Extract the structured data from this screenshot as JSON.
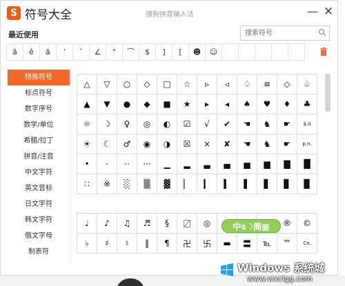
{
  "window": {
    "logo_letter": "S",
    "title": "符号大全",
    "ime_name": "搜狗拼音输入法",
    "minimize": "—",
    "close": "✕"
  },
  "recent": {
    "label": "最近使用",
    "symbols": [
      "ä",
      "ê",
      "ã",
      "’",
      "˘",
      "∠",
      "°",
      "⌒",
      "$",
      "]",
      "[",
      "☻",
      "☺",
      "",
      "",
      "",
      "",
      ""
    ]
  },
  "search": {
    "placeholder": "搜索符号"
  },
  "sidebar": {
    "items": [
      {
        "label": "特殊符号",
        "active": true
      },
      {
        "label": "标点符号"
      },
      {
        "label": "数字序号"
      },
      {
        "label": "数学/单位"
      },
      {
        "label": "希腊/拉丁"
      },
      {
        "label": "拼音/注音"
      },
      {
        "label": "中文字符"
      },
      {
        "label": "英文音标"
      },
      {
        "label": "日文字符"
      },
      {
        "label": "韩文字符"
      },
      {
        "label": "俄文字母"
      },
      {
        "label": "制表符"
      }
    ]
  },
  "grid1": [
    "△",
    "▽",
    "○",
    "◇",
    "□",
    "☆",
    "▹",
    "◃",
    "♤",
    "≡",
    "◇",
    "♧",
    "▲",
    "▼",
    "●",
    "◆",
    "■",
    "★",
    "▸",
    "◂",
    "♠",
    "♥",
    "♦",
    "♣",
    "☼",
    "☽",
    "♀",
    "◎",
    "◐",
    "☑",
    "√",
    "✔",
    "☚",
    "♞",
    "☛",
    "ā.ū",
    "☀",
    "☾",
    "♂",
    "◉",
    "◑",
    "☒",
    "×",
    "✘",
    "☚",
    "♞",
    "☛",
    "p.n.",
    "•",
    "·",
    "··",
    "···",
    "▁",
    "▂",
    "▃",
    "▄",
    "▅",
    "▆",
    "▇",
    "█",
    "∷",
    "※",
    "░",
    "▒",
    "▓",
    "▏",
    "▎",
    "▍",
    "▌",
    "▋",
    "▊",
    "▉"
  ],
  "grid2": [
    "♩",
    "♪",
    "♫",
    "♬",
    "§",
    "〼",
    "◎",
    "",
    "",
    "",
    "®",
    "©",
    "♭",
    "♯",
    "♮",
    "‖",
    "¶",
    "卍",
    "卐",
    "▬",
    "〓",
    "℡",
    "™",
    "Co."
  ],
  "sticker": "中s☽简▦",
  "watermark": {
    "title": "Windows 系统城",
    "url": "www.wxclgg.com"
  }
}
